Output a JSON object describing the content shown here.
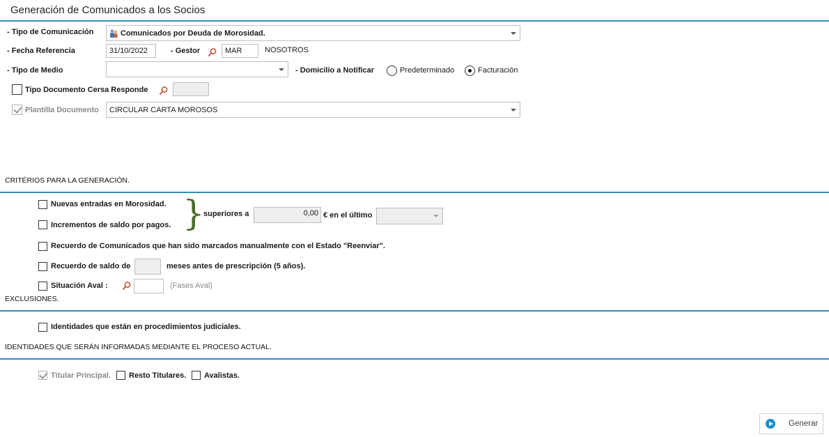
{
  "window": {
    "title": "Generación de Comunicados a los Socios"
  },
  "form": {
    "tipo_comunicacion": {
      "label": "- Tipo de Comunicación",
      "value": "Comunicados por Deuda de Morosidad.",
      "icon": "people-icon"
    },
    "fecha_referencia": {
      "label": "- Fecha Referencia",
      "value": "31/10/2022"
    },
    "gestor": {
      "label": "- Gestor",
      "code": "MAR",
      "name": "NOSOTROS"
    },
    "tipo_medio": {
      "label": "- Tipo de Medio",
      "value": ""
    },
    "domicilio": {
      "label": "- Domicilio a Notificar",
      "options": [
        "Predeterminado",
        "Facturación"
      ],
      "selected": "Facturación"
    },
    "tipo_documento": {
      "label": "Tipo Documento Cersa Responde",
      "checked": false,
      "value": ""
    },
    "plantilla": {
      "label": "Plantilla Documento",
      "checked": true,
      "disabled": true,
      "value": "CIRCULAR CARTA MOROSOS"
    }
  },
  "criterios": {
    "heading": "CRITÉRIOS PARA LA GENERACIÓN.",
    "nuevas_entradas": {
      "label": "Nuevas entradas en Morosidad.",
      "checked": false
    },
    "incrementos": {
      "label": "Incrementos de saldo por pagos.",
      "checked": false
    },
    "superiores_label": "superiores a",
    "superiores_value": "0,00",
    "ultimo_label": "€ en el último",
    "ultimo_value": "",
    "recuerdo_comunicados": {
      "label": "Recuerdo de Comunicados que han sido marcados manualmente con el Estado \"Reenviar\".",
      "checked": false
    },
    "recuerdo_saldo": {
      "label": "Recuerdo de saldo de",
      "value": "",
      "suffix": "meses antes de prescripción (5 años).",
      "checked": false
    },
    "situacion_aval": {
      "label": "Situación Aval :",
      "value": "",
      "hint": "(Fases Aval)",
      "checked": false
    }
  },
  "exclusiones": {
    "heading": "EXCLUSIONES.",
    "identidades": {
      "label": "Identidades que están en procedimientos judiciales.",
      "checked": false
    }
  },
  "identidades": {
    "heading": "IDENTIDADES QUE SERÁN INFORMADAS MEDIANTE EL PROCESO ACTUAL.",
    "titular_principal": {
      "label": "Titular Principal.",
      "checked": true,
      "disabled": true
    },
    "resto_titulares": {
      "label": "Resto Titulares.",
      "checked": false
    },
    "avalistas": {
      "label": "Avalistas.",
      "checked": false
    }
  },
  "actions": {
    "generar_label": "Generar"
  },
  "colors": {
    "accent": "#2a8db3",
    "search_icon": "#c0502d",
    "brace": "#4a6d2b"
  }
}
